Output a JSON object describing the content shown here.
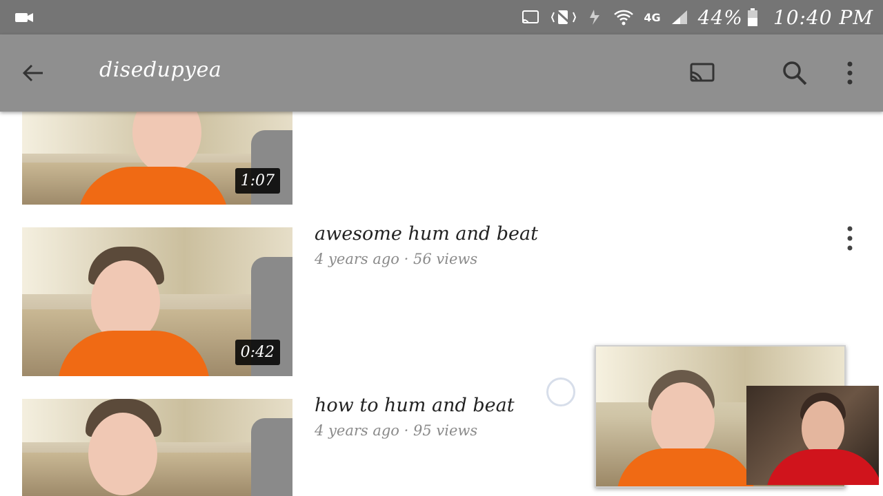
{
  "status_bar": {
    "battery": "44%",
    "time": "10:40 PM",
    "network": "4G",
    "icons": [
      "video-camera-icon",
      "cast-icon",
      "vibrate-icon",
      "data-arrows-icon",
      "wifi-icon",
      "signal-icon",
      "battery-icon"
    ]
  },
  "app_bar": {
    "title": "disedupyea",
    "icons": [
      "back-arrow-icon",
      "cast-icon",
      "search-icon",
      "more-vertical-icon"
    ]
  },
  "videos": [
    {
      "duration": "1:07",
      "title": "",
      "meta": ""
    },
    {
      "duration": "0:42",
      "title": "awesome hum and beat",
      "meta": "4 years ago · 56 views"
    },
    {
      "duration": "",
      "title": "how to hum and beat",
      "meta": "4 years ago · 95 views"
    }
  ],
  "colors": {
    "status_bar": "#757575",
    "app_bar": "#8f8f8f",
    "shirt": "#f06a14"
  }
}
